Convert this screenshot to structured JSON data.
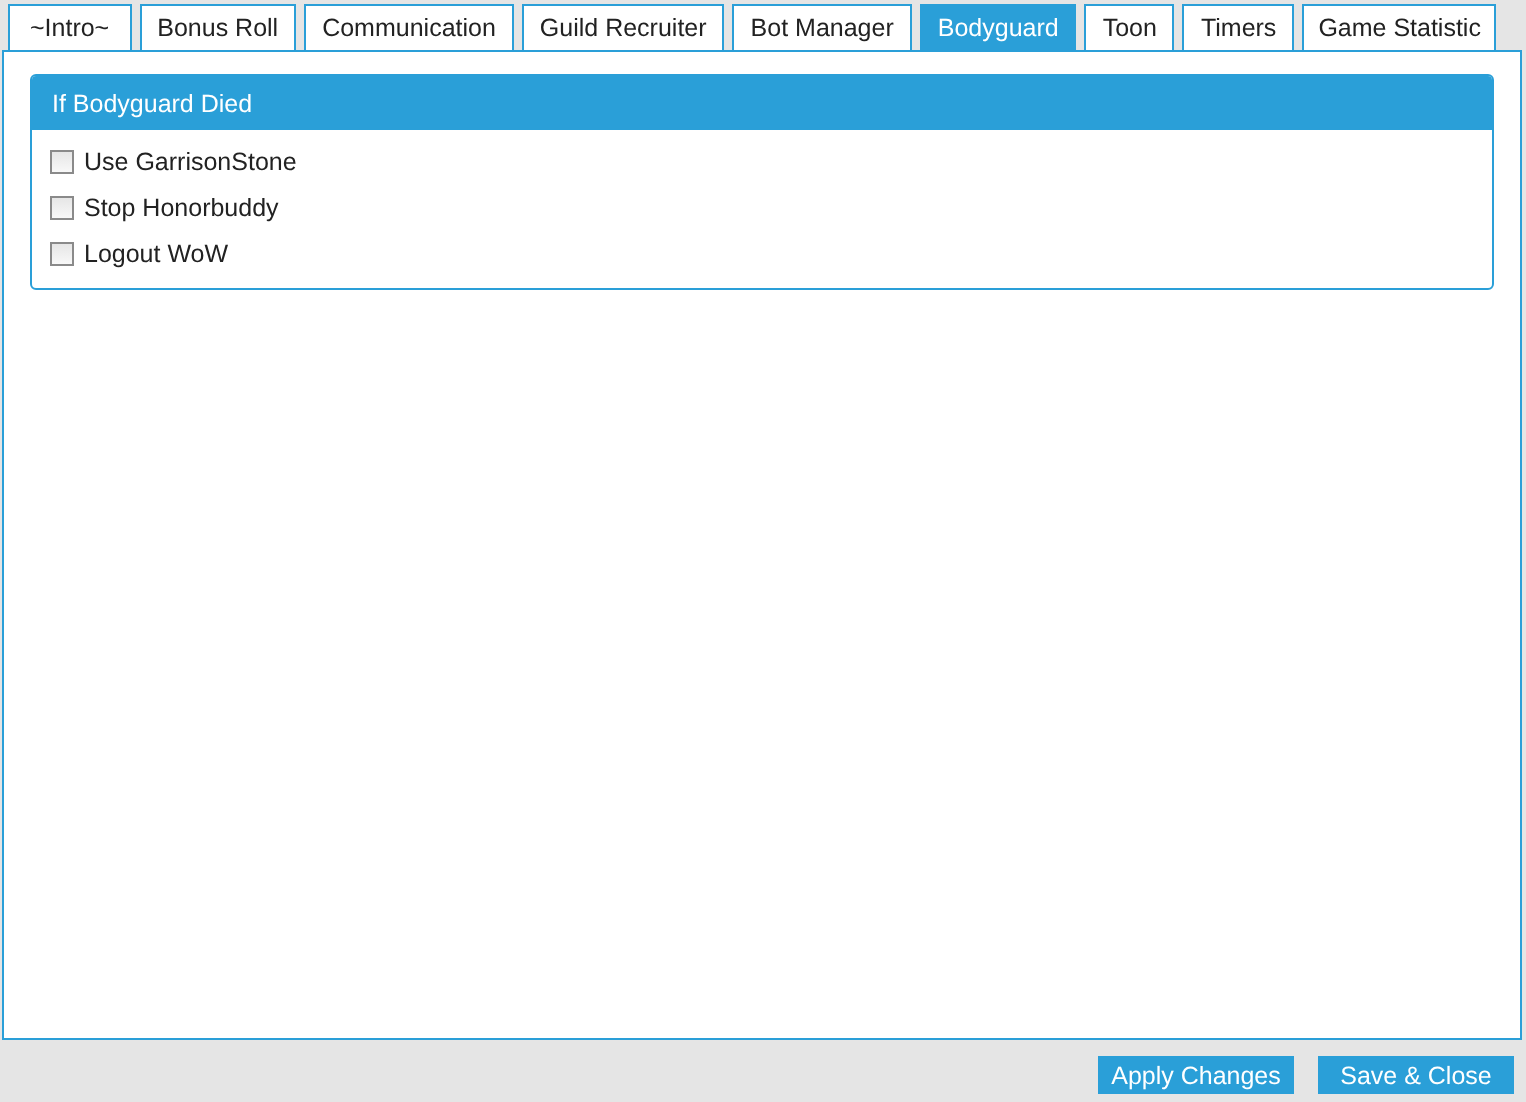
{
  "tabs": [
    {
      "label": "~Intro~",
      "selected": false
    },
    {
      "label": "Bonus Roll",
      "selected": false
    },
    {
      "label": "Communication",
      "selected": false
    },
    {
      "label": "Guild Recruiter",
      "selected": false
    },
    {
      "label": "Bot Manager",
      "selected": false
    },
    {
      "label": "Bodyguard",
      "selected": true
    },
    {
      "label": "Toon",
      "selected": false
    },
    {
      "label": "Timers",
      "selected": false
    },
    {
      "label": "Game Statistic",
      "selected": false
    }
  ],
  "group": {
    "title": "If Bodyguard Died",
    "options": [
      {
        "label": "Use GarrisonStone",
        "checked": false
      },
      {
        "label": "Stop Honorbuddy",
        "checked": false
      },
      {
        "label": "Logout WoW",
        "checked": false
      }
    ]
  },
  "buttons": [
    "Apply Changes",
    "Save & Close"
  ]
}
